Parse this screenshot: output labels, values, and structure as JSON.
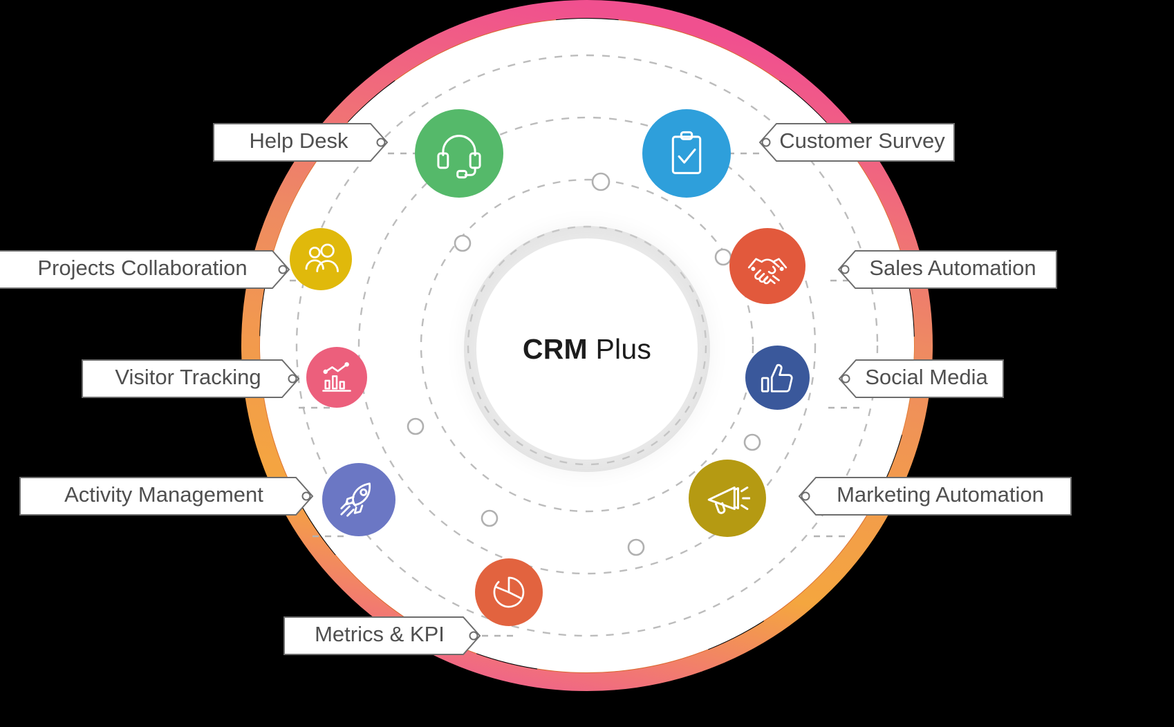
{
  "diagram": {
    "title": "CRM Plus feature wheel",
    "center": {
      "bold_text": "CRM",
      "light_text": "Plus"
    },
    "background_color": "#000000",
    "ring": {
      "gradient_top": "#F0588E",
      "gradient_mid": "#EE8268",
      "gradient_bottom": "#F5A63F",
      "inner_ring_color": "#D9662E",
      "accent_ring_color": "#E8933A"
    },
    "chip_style": {
      "fill": "#FFFFFF",
      "border": "#6D6D6D",
      "text_color": "#4F4F4F"
    },
    "connector_color": "#B3B3B3",
    "nodes": [
      {
        "id": "help-desk",
        "label": "Help Desk",
        "icon": "headset-icon",
        "color": "#55B96A",
        "side": "left"
      },
      {
        "id": "customer-survey",
        "label": "Customer Survey",
        "icon": "clipboard-check-icon",
        "color": "#2E9FDB",
        "side": "right"
      },
      {
        "id": "projects-collaboration",
        "label": "Projects Collaboration",
        "icon": "people-group-icon",
        "color": "#E0B90B",
        "side": "left"
      },
      {
        "id": "sales-automation",
        "label": "Sales Automation",
        "icon": "handshake-icon",
        "color": "#E2593C",
        "side": "right"
      },
      {
        "id": "visitor-tracking",
        "label": "Visitor Tracking",
        "icon": "bar-chart-trend-icon",
        "color": "#EC5F7C",
        "side": "left"
      },
      {
        "id": "social-media",
        "label": "Social Media",
        "icon": "thumbs-up-icon",
        "color": "#3A589B",
        "side": "right"
      },
      {
        "id": "activity-management",
        "label": "Activity Management",
        "icon": "rocket-icon",
        "color": "#6B77C4",
        "side": "left"
      },
      {
        "id": "marketing-automation",
        "label": "Marketing Automation",
        "icon": "megaphone-icon",
        "color": "#B59A12",
        "side": "right"
      },
      {
        "id": "metrics-kpi",
        "label": "Metrics & KPI",
        "icon": "pie-chart-icon",
        "color": "#E2633F",
        "side": "left"
      }
    ]
  }
}
